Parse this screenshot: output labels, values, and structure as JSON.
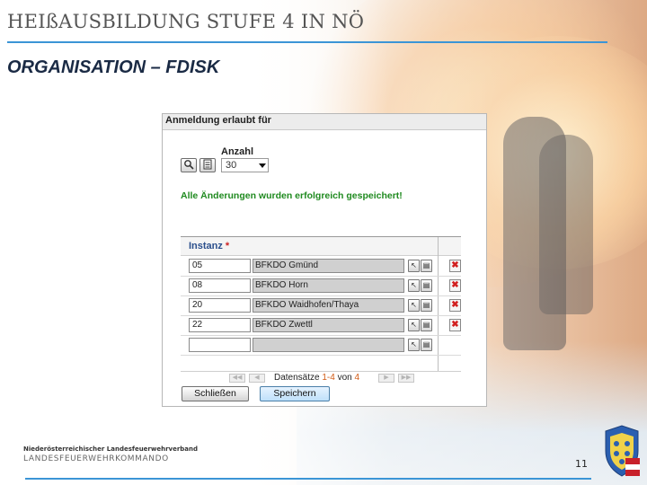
{
  "slide": {
    "title": "HEIßAUSBILDUNG STUFE 4 IN NÖ",
    "subtitle": "ORGANISATION – FDISK",
    "page_number": "11",
    "footer_org": "Niederösterreichischer Landesfeuerwehrverband",
    "footer_command": "LANDESFEUERWEHRKOMMANDO"
  },
  "dialog": {
    "header": "Anmeldung erlaubt für",
    "count_label": "Anzahl",
    "count_value": "30",
    "success_message": "Alle Änderungen wurden erfolgreich gespeichert!",
    "column_header": "Instanz",
    "required_mark": "*",
    "rows": [
      {
        "number": "05",
        "name": "BFKDO Gmünd"
      },
      {
        "number": "08",
        "name": "BFKDO Horn"
      },
      {
        "number": "20",
        "name": "BFKDO Waidhofen/Thaya"
      },
      {
        "number": "22",
        "name": "BFKDO Zwettl"
      },
      {
        "number": "",
        "name": ""
      }
    ],
    "pager": {
      "prefix": "Datensätze",
      "range": "1-4",
      "of": "von",
      "total": "4"
    },
    "close_label": "Schließen",
    "save_label": "Speichern"
  },
  "colors": {
    "accent_line": "#3b95d6",
    "success": "#1f8a1f",
    "delete": "#d21f1f",
    "column_header": "#2b4f8c"
  },
  "icons": [
    "search-icon",
    "list-icon",
    "select-pointer-icon",
    "table-icon",
    "delete-icon",
    "first-page-icon",
    "prev-page-icon",
    "next-page-icon",
    "last-page-icon"
  ]
}
